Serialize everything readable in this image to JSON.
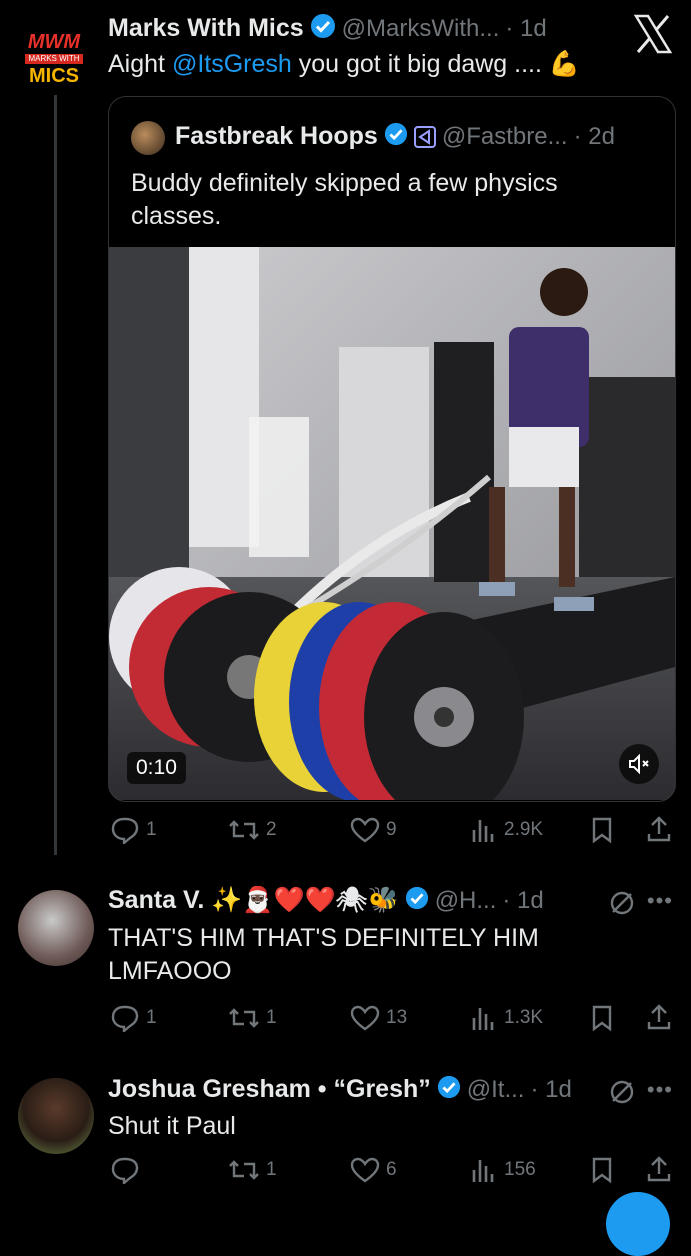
{
  "main_tweet": {
    "logo": {
      "line1": "MWM",
      "line2": "MARKS WITH",
      "line3": "MICS"
    },
    "name": "Marks With Mics",
    "handle": "@MarksWith...",
    "time": "· 1d",
    "text_prefix": "Aight ",
    "mention": "@ItsGresh",
    "text_suffix": " you got it big dawg .... 💪",
    "quote": {
      "name": "Fastbreak Hoops",
      "handle": "@Fastbre...",
      "time": "· 2d",
      "text": "Buddy definitely skipped a few physics classes.",
      "video_time": "0:10"
    },
    "actions": {
      "replies": "1",
      "reposts": "2",
      "likes": "9",
      "views": "2.9K"
    }
  },
  "replies": [
    {
      "name": "Santa V. ✨🎅🏿❤️❤️🕷🐝",
      "handle": "@H...",
      "time": "· 1d",
      "text": "THAT'S HIM THAT'S DEFINITELY HIM LMFAOOO",
      "actions": {
        "replies": "1",
        "reposts": "1",
        "likes": "13",
        "views": "1.3K"
      }
    },
    {
      "name": "Joshua Gresham • “Gresh”",
      "handle": "@It...",
      "time": "· 1d",
      "text": "Shut it Paul",
      "actions": {
        "replies": "",
        "reposts": "1",
        "likes": "6",
        "views": "156"
      }
    }
  ],
  "colors": {
    "accent": "#1d9bf0",
    "muted": "#71767b",
    "text": "#e7e9ea",
    "bg": "#000000"
  },
  "icons": {
    "close": "x-logo-icon",
    "reply": "reply-icon",
    "repost": "repost-icon",
    "like": "heart-icon",
    "views": "views-icon",
    "bookmark": "bookmark-icon",
    "share": "share-icon"
  }
}
